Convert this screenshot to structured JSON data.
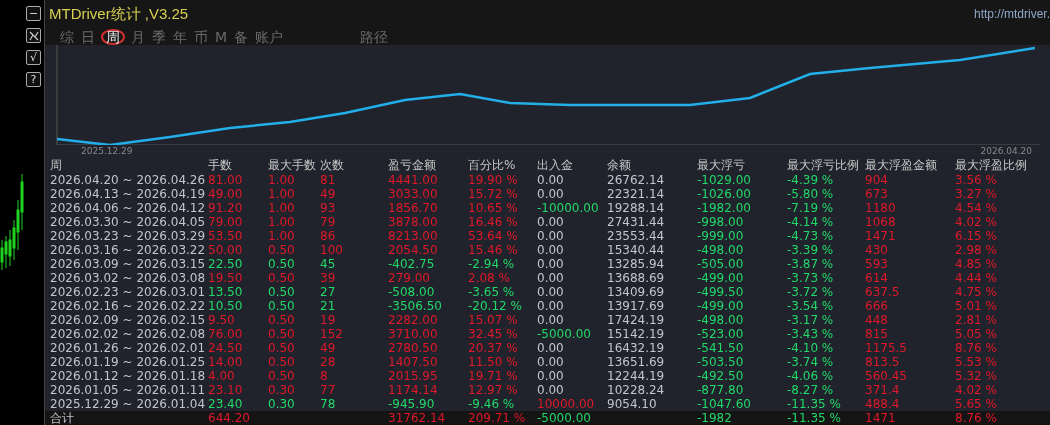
{
  "window": {
    "title": "MTDriver统计 ,V3.25",
    "url": "http://mtdriver."
  },
  "side_buttons": [
    {
      "kind": "text",
      "label": "−"
    },
    {
      "kind": "icon"
    },
    {
      "kind": "text",
      "label": "√"
    },
    {
      "kind": "text",
      "label": "?"
    }
  ],
  "tabs": [
    {
      "label": "综",
      "selected": false
    },
    {
      "label": "日",
      "selected": false
    },
    {
      "label": "周",
      "selected": true
    },
    {
      "label": "月",
      "selected": false
    },
    {
      "label": "季",
      "selected": false
    },
    {
      "label": "年",
      "selected": false
    },
    {
      "label": "币",
      "selected": false
    },
    {
      "label": "M",
      "selected": false
    },
    {
      "label": "备",
      "selected": false
    },
    {
      "label": "账户",
      "selected": false
    },
    {
      "label": "路径",
      "selected": false
    }
  ],
  "chart": {
    "start_label": "2025.12.29",
    "end_label": "2026.04.20"
  },
  "table": {
    "columns": [
      "周",
      "手数",
      "最大手数",
      "次数",
      "盈亏金额",
      "百分比%",
      "出入金",
      "余额",
      "最大浮亏",
      "最大浮亏比例",
      "最大浮盈金额",
      "最大浮盈比例"
    ],
    "rows": [
      {
        "profit": true,
        "withdrawal": false,
        "deposit": false,
        "cells": [
          "2026.04.20 ~ 2026.04.26",
          "81.00",
          "1.00",
          "81",
          "4441.00",
          "19.90 %",
          "0.00",
          "26762.14",
          "-1029.00",
          "-4.39 %",
          "904",
          "3.56 %"
        ]
      },
      {
        "profit": true,
        "withdrawal": false,
        "deposit": false,
        "cells": [
          "2026.04.13 ~ 2026.04.19",
          "49.00",
          "1.00",
          "49",
          "3033.00",
          "15.72 %",
          "0.00",
          "22321.14",
          "-1026.00",
          "-5.80 %",
          "673",
          "3.27 %"
        ]
      },
      {
        "profit": true,
        "withdrawal": true,
        "deposit": false,
        "cells": [
          "2026.04.06 ~ 2026.04.12",
          "91.20",
          "1.00",
          "93",
          "1856.70",
          "10.65 %",
          "-10000.00",
          "19288.14",
          "-1982.00",
          "-7.19 %",
          "1180",
          "4.54 %"
        ]
      },
      {
        "profit": true,
        "withdrawal": false,
        "deposit": false,
        "cells": [
          "2026.03.30 ~ 2026.04.05",
          "79.00",
          "1.00",
          "79",
          "3878.00",
          "16.46 %",
          "0.00",
          "27431.44",
          "-998.00",
          "-4.14 %",
          "1068",
          "4.02 %"
        ]
      },
      {
        "profit": true,
        "withdrawal": false,
        "deposit": false,
        "cells": [
          "2026.03.23 ~ 2026.03.29",
          "53.50",
          "1.00",
          "86",
          "8213.00",
          "53.64 %",
          "0.00",
          "23553.44",
          "-999.00",
          "-4.73 %",
          "1471",
          "6.15 %"
        ]
      },
      {
        "profit": true,
        "withdrawal": false,
        "deposit": false,
        "cells": [
          "2026.03.16 ~ 2026.03.22",
          "50.00",
          "0.50",
          "100",
          "2054.50",
          "15.46 %",
          "0.00",
          "15340.44",
          "-498.00",
          "-3.39 %",
          "430",
          "2.98 %"
        ]
      },
      {
        "profit": false,
        "withdrawal": false,
        "deposit": false,
        "cells": [
          "2026.03.09 ~ 2026.03.15",
          "22.50",
          "0.50",
          "45",
          "-402.75",
          "-2.94 %",
          "0.00",
          "13285.94",
          "-505.00",
          "-3.87 %",
          "593",
          "4.85 %"
        ]
      },
      {
        "profit": true,
        "withdrawal": false,
        "deposit": false,
        "cells": [
          "2026.03.02 ~ 2026.03.08",
          "19.50",
          "0.50",
          "39",
          "279.00",
          "2.08 %",
          "0.00",
          "13688.69",
          "-499.00",
          "-3.73 %",
          "614",
          "4.44 %"
        ]
      },
      {
        "profit": false,
        "withdrawal": false,
        "deposit": false,
        "cells": [
          "2026.02.23 ~ 2026.03.01",
          "13.50",
          "0.50",
          "27",
          "-508.00",
          "-3.65 %",
          "0.00",
          "13409.69",
          "-499.50",
          "-3.72 %",
          "637.5",
          "4.75 %"
        ]
      },
      {
        "profit": false,
        "withdrawal": false,
        "deposit": false,
        "cells": [
          "2026.02.16 ~ 2026.02.22",
          "10.50",
          "0.50",
          "21",
          "-3506.50",
          "-20.12 %",
          "0.00",
          "13917.69",
          "-499.00",
          "-3.54 %",
          "666",
          "5.01 %"
        ]
      },
      {
        "profit": true,
        "withdrawal": false,
        "deposit": false,
        "cells": [
          "2026.02.09 ~ 2026.02.15",
          "9.50",
          "0.50",
          "19",
          "2282.00",
          "15.07 %",
          "0.00",
          "17424.19",
          "-498.00",
          "-3.17 %",
          "448",
          "2.81 %"
        ]
      },
      {
        "profit": true,
        "withdrawal": true,
        "deposit": false,
        "cells": [
          "2026.02.02 ~ 2026.02.08",
          "76.00",
          "0.50",
          "152",
          "3710.00",
          "32.45 %",
          "-5000.00",
          "15142.19",
          "-523.00",
          "-3.43 %",
          "815",
          "5.05 %"
        ]
      },
      {
        "profit": true,
        "withdrawal": false,
        "deposit": false,
        "cells": [
          "2026.01.26 ~ 2026.02.01",
          "24.50",
          "0.50",
          "49",
          "2780.50",
          "20.37 %",
          "0.00",
          "16432.19",
          "-541.50",
          "-4.10 %",
          "1175.5",
          "8.76 %"
        ]
      },
      {
        "profit": true,
        "withdrawal": false,
        "deposit": false,
        "cells": [
          "2026.01.19 ~ 2026.01.25",
          "14.00",
          "0.50",
          "28",
          "1407.50",
          "11.50 %",
          "0.00",
          "13651.69",
          "-503.50",
          "-3.74 %",
          "813.5",
          "5.53 %"
        ]
      },
      {
        "profit": true,
        "withdrawal": false,
        "deposit": false,
        "cells": [
          "2026.01.12 ~ 2026.01.18",
          "4.00",
          "0.50",
          "8",
          "2015.95",
          "19.71 %",
          "0.00",
          "12244.19",
          "-492.50",
          "-4.06 %",
          "560.45",
          "5.32 %"
        ]
      },
      {
        "profit": true,
        "withdrawal": false,
        "deposit": false,
        "cells": [
          "2026.01.05 ~ 2026.01.11",
          "23.10",
          "0.30",
          "77",
          "1174.14",
          "12.97 %",
          "0.00",
          "10228.24",
          "-877.80",
          "-8.27 %",
          "371.4",
          "4.02 %"
        ]
      },
      {
        "profit": false,
        "withdrawal": false,
        "deposit": true,
        "cells": [
          "2025.12.29 ~ 2026.01.04",
          "23.40",
          "0.30",
          "78",
          "-945.90",
          "-9.46 %",
          "10000.00",
          "9054.10",
          "-1047.60",
          "-11.35 %",
          "488.4",
          "5.65 %"
        ]
      }
    ],
    "total": {
      "label": "合计",
      "lots": "644.20",
      "profit": "31762.14",
      "percent": "209.71 %",
      "flow": "-5000.00",
      "max_float_loss": "-1982",
      "max_float_loss_pct": "-11.35 %",
      "max_float_profit": "1471",
      "max_float_profit_pct": "8.76 %"
    }
  }
}
